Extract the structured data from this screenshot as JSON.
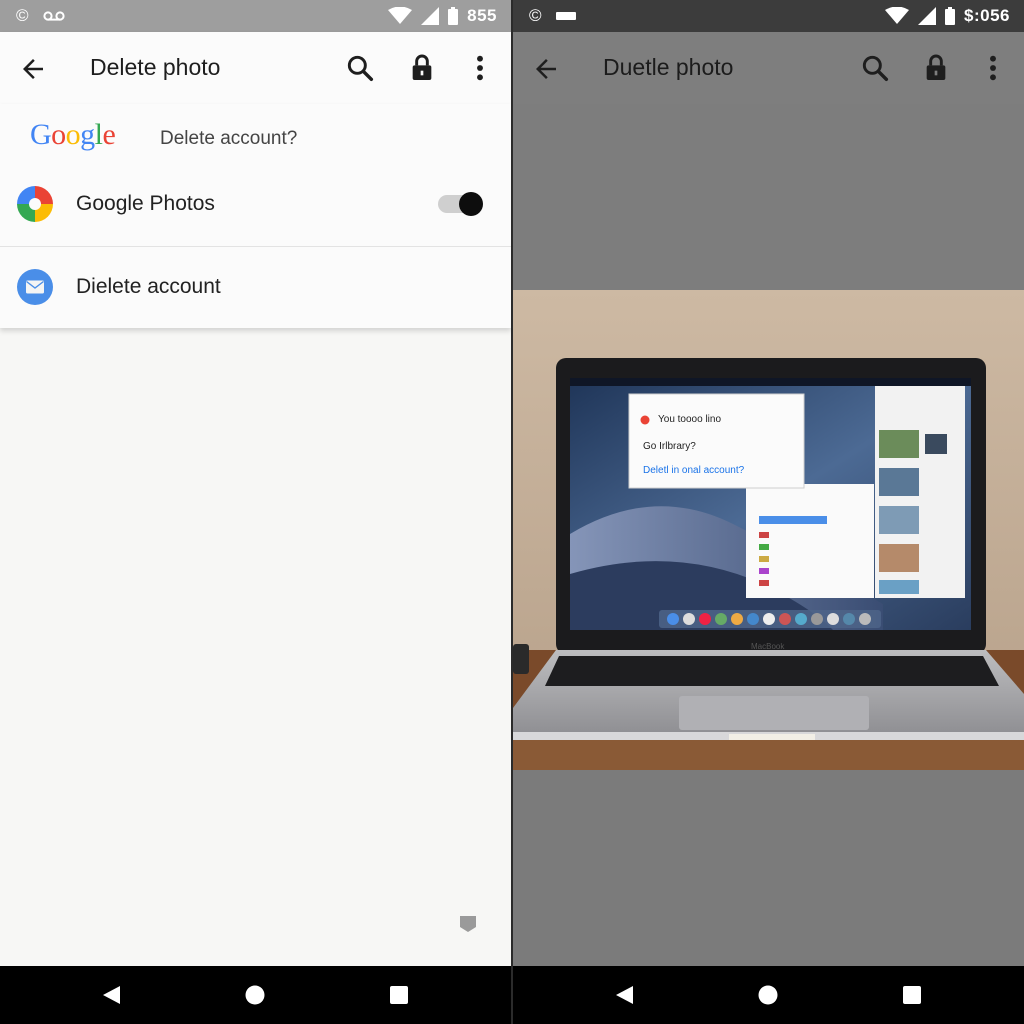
{
  "left": {
    "status": {
      "left_glyph": "©",
      "time": "855"
    },
    "appbar": {
      "title": "Delete photo",
      "icons": [
        "back-arrow-icon",
        "search-icon",
        "lock-icon",
        "more-vert-icon"
      ]
    },
    "card": {
      "logo_text": "Google",
      "question": "Delete account?",
      "rows": [
        {
          "label": "Google Photos",
          "icon": "google-photos-icon",
          "toggle_on": true
        },
        {
          "label": "Dielete account",
          "icon": "mail-icon"
        }
      ]
    }
  },
  "right": {
    "status": {
      "left_glyph": "©",
      "time": "$:056"
    },
    "appbar": {
      "title": "Duetle photo",
      "icons": [
        "back-arrow-icon",
        "search-icon",
        "lock-icon",
        "more-vert-icon"
      ]
    },
    "laptop_screen": {
      "dialog": {
        "heading": "You toooo lino",
        "line": "Go Irlbrary?",
        "link": "Deletl in onal account?"
      },
      "brand": "MacBook"
    }
  },
  "colors": {
    "google_blue": "#4285F4",
    "google_red": "#EA4335",
    "google_yellow": "#FBBC05",
    "google_green": "#34A853",
    "link_blue": "#1a73e8"
  }
}
